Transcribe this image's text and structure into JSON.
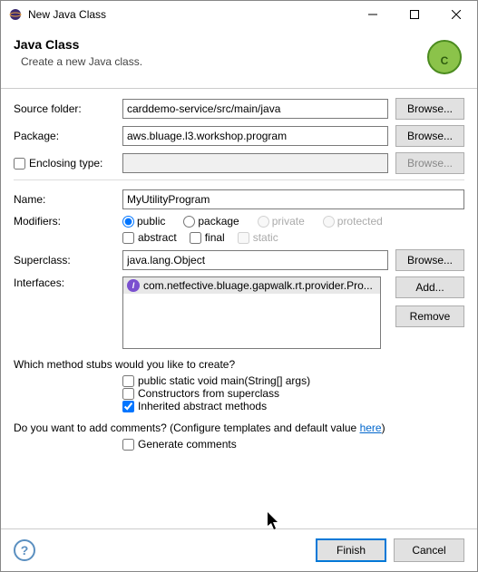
{
  "window": {
    "title": "New Java Class"
  },
  "header": {
    "title": "Java Class",
    "subtitle": "Create a new Java class."
  },
  "labels": {
    "source_folder": "Source folder:",
    "package": "Package:",
    "enclosing": "Enclosing type:",
    "name": "Name:",
    "modifiers": "Modifiers:",
    "superclass": "Superclass:",
    "interfaces": "Interfaces:"
  },
  "values": {
    "source_folder": "carddemo-service/src/main/java",
    "package": "aws.bluage.l3.workshop.program",
    "enclosing": "",
    "name": "MyUtilityProgram",
    "superclass": "java.lang.Object"
  },
  "modifiers": {
    "public": "public",
    "package": "package",
    "private": "private",
    "protected": "protected",
    "abstract": "abstract",
    "final": "final",
    "static": "static"
  },
  "interfaces": {
    "item0": "com.netfective.bluage.gapwalk.rt.provider.Pro..."
  },
  "buttons": {
    "browse": "Browse...",
    "add": "Add...",
    "remove": "Remove",
    "finish": "Finish",
    "cancel": "Cancel"
  },
  "stubs": {
    "question": "Which method stubs would you like to create?",
    "main": "public static void main(String[] args)",
    "constructors": "Constructors from superclass",
    "inherited": "Inherited abstract methods"
  },
  "comments": {
    "question_pre": "Do you want to add comments? (Configure templates and default value ",
    "link": "here",
    "question_post": ")",
    "generate": "Generate comments"
  }
}
